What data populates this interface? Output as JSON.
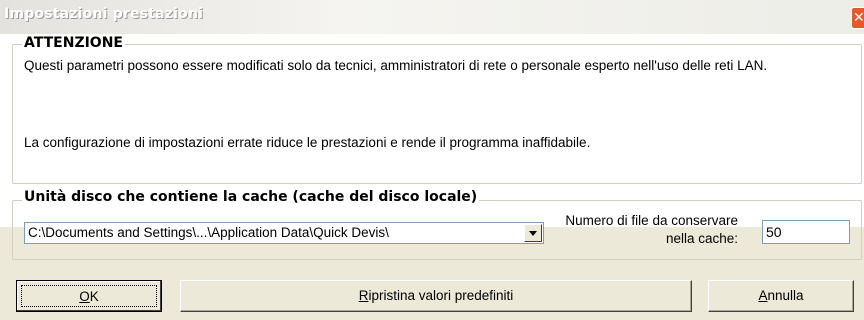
{
  "window": {
    "title": "Impostazioni prestazioni",
    "close_glyph": "✕"
  },
  "warning": {
    "heading": "ATTENZIONE",
    "line1": "Questi parametri possono essere modificati solo da tecnici, amministratori di rete o personale esperto nell'uso delle reti LAN.",
    "line2": "La configurazione di impostazioni errate riduce le prestazioni e rende il programma inaffidabile."
  },
  "cache": {
    "heading": "Unità disco che contiene la cache (cache del disco locale)",
    "path_value": "C:\\Documents and Settings\\...\\Application Data\\Quick Devis\\",
    "count_label_line1": "Numero di file da conservare",
    "count_label_line2": "nella cache:",
    "count_value": "50"
  },
  "buttons": {
    "ok_mnemonic": "O",
    "ok_rest": "K",
    "reset_mnemonic": "R",
    "reset_rest": "ipristina valori predefiniti",
    "cancel_mnemonic": "A",
    "cancel_rest": "nnulla"
  },
  "colors": {
    "dialog_bg": "#ECE9D8",
    "close_button": "#E45A2D",
    "input_border": "#7F9DB9"
  }
}
